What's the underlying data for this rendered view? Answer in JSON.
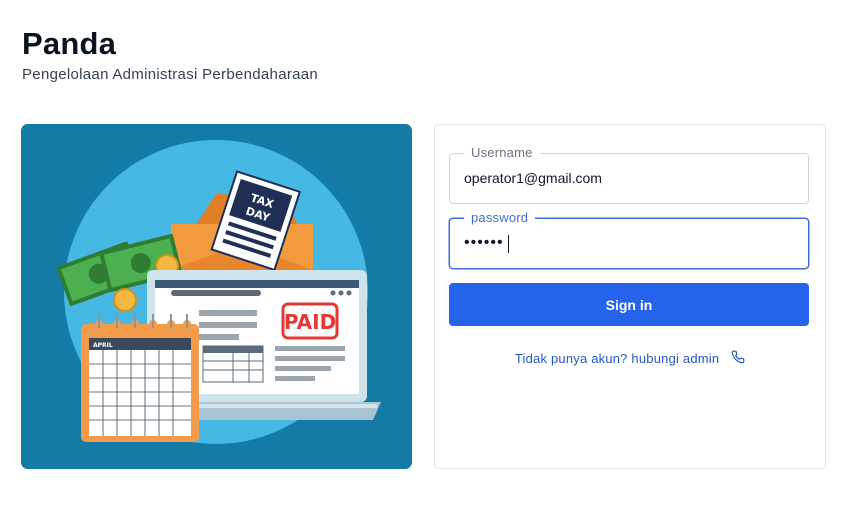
{
  "header": {
    "title": "Panda",
    "subtitle": "Pengelolaan Administrasi Perbendaharaan"
  },
  "illustration": {
    "envelope_card_text_1": "TAX",
    "envelope_card_text_2": "DAY",
    "stamp_text": "PAID",
    "calendar_month": "APRIL",
    "colors": {
      "background": "#147aa6",
      "circle": "#45b8e4",
      "envelope": "#f29b3c",
      "money": "#4caf50",
      "calendar": "#f39a4b",
      "stamp": "#e53935"
    }
  },
  "login": {
    "username_label": "Username",
    "username_value": "operator1@gmail.com",
    "password_label": "password",
    "password_value": "••••••",
    "signin_label": "Sign in",
    "contact_text": "Tidak punya akun? hubungi admin",
    "contact_icon": "phone-icon",
    "accent_color": "#2563eb"
  }
}
